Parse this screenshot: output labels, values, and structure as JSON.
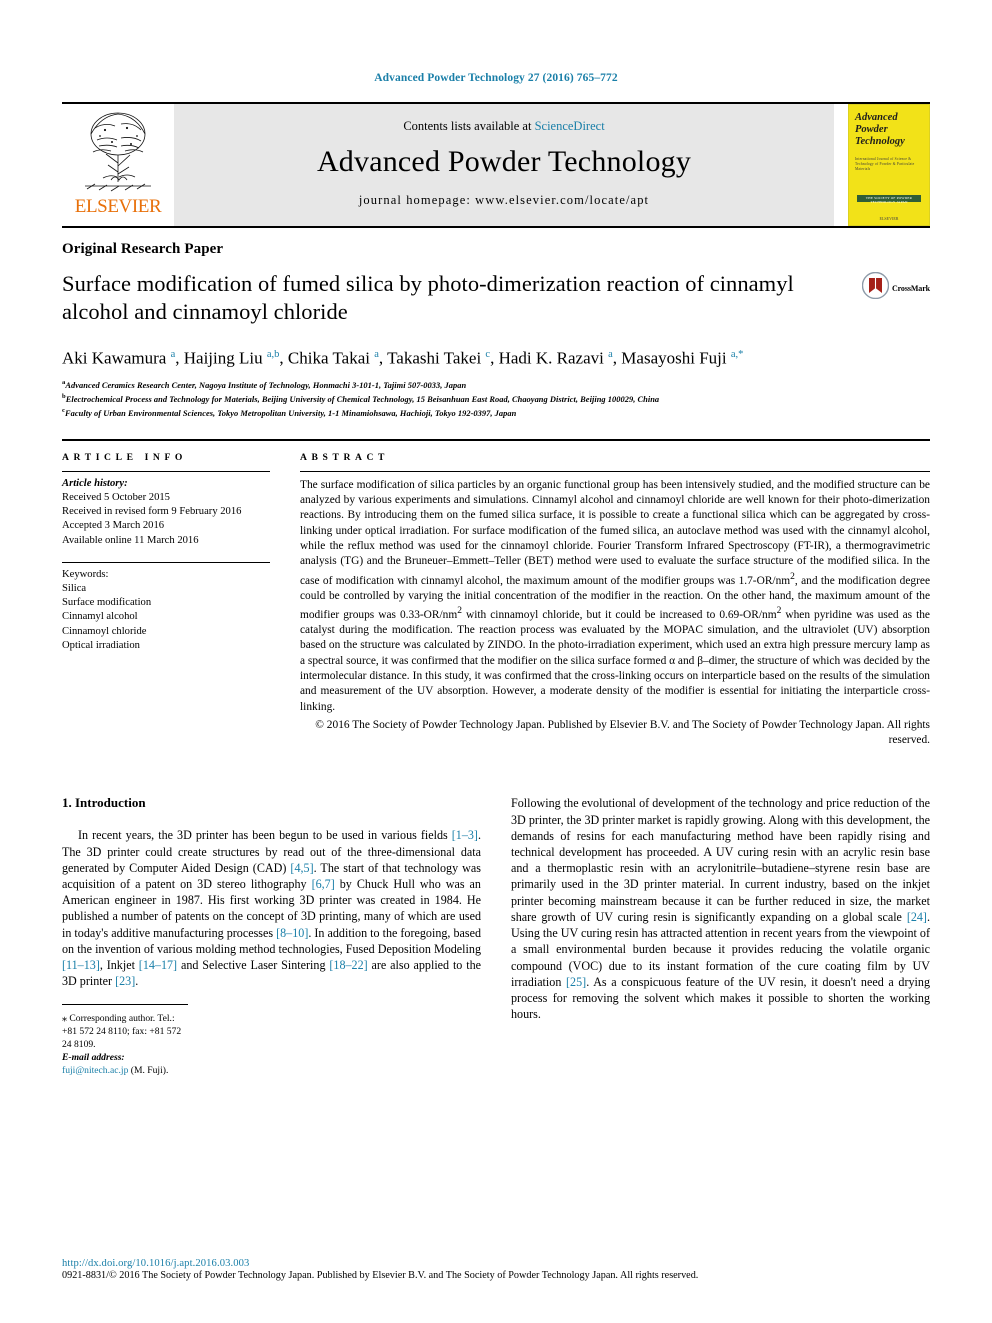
{
  "running_head": "Advanced Powder Technology 27 (2016) 765–772",
  "masthead": {
    "publisher_name": "ELSEVIER",
    "contents_prefix": "Contents lists available at ",
    "contents_link": "ScienceDirect",
    "journal_title": "Advanced Powder Technology",
    "homepage_line": "journal homepage: www.elsevier.com/locate/apt",
    "cover": {
      "line1": "Advanced",
      "line2": "Powder",
      "line3": "Technology",
      "subtitle": "International Journal of Science & Technology of Powder & Particulate Materials",
      "band_text": "THE SOCIETY OF POWDER TECHNOLOGY JAPAN",
      "foot_text": "ELSEVIER"
    }
  },
  "article": {
    "type": "Original Research Paper",
    "title": "Surface modification of fumed silica by photo-dimerization reaction of cinnamyl alcohol and cinnamoyl chloride",
    "crossmark_label": "CrossMark",
    "authors": "Aki Kawamura a , Haijing Liu a,b , Chika Takai a , Takashi Takei c , Hadi K. Razavi a , Masayoshi Fuji a,*",
    "affiliations": [
      {
        "marker": "a",
        "text": "Advanced Ceramics Research Center, Nagoya Institute of Technology, Honmachi 3-101-1, Tajimi 507-0033, Japan"
      },
      {
        "marker": "b",
        "text": "Electrochemical Process and Technology for Materials, Beijing University of Chemical Technology, 15 Beisanhuan East Road, Chaoyang District, Beijing 100029, China"
      },
      {
        "marker": "c",
        "text": "Faculty of Urban Environmental Sciences, Tokyo Metropolitan University, 1-1 Minamiohsawa, Hachioji, Tokyo 192-0397, Japan"
      }
    ]
  },
  "article_info": {
    "heading": "ARTICLE INFO",
    "history_label": "Article history:",
    "history": [
      "Received 5 October 2015",
      "Received in revised form 9 February 2016",
      "Accepted 3 March 2016",
      "Available online 11 March 2016"
    ],
    "keywords_label": "Keywords:",
    "keywords": [
      "Silica",
      "Surface modification",
      "Cinnamyl alcohol",
      "Cinnamoyl chloride",
      "Optical irradiation"
    ]
  },
  "abstract": {
    "heading": "ABSTRACT",
    "text": "The surface modification of silica particles by an organic functional group has been intensively studied, and the modified structure can be analyzed by various experiments and simulations. Cinnamyl alcohol and cinnamoyl chloride are well known for their photo-dimerization reactions. By introducing them on the fumed silica surface, it is possible to create a functional silica which can be aggregated by cross-linking under optical irradiation. For surface modification of the fumed silica, an autoclave method was used with the cinnamyl alcohol, while the reflux method was used for the cinnamoyl chloride. Fourier Transform Infrared Spectroscopy (FT-IR), a thermogravimetric analysis (TG) and the Bruneuer–Emmett–Teller (BET) method were used to evaluate the surface structure of the modified silica. In the case of modification with cinnamyl alcohol, the maximum amount of the modifier groups was 1.7-OR/nm2, and the modification degree could be controlled by varying the initial concentration of the modifier in the reaction. On the other hand, the maximum amount of the modifier groups was 0.33-OR/nm2 with cinnamoyl chloride, but it could be increased to 0.69-OR/nm2 when pyridine was used as the catalyst during the modification. The reaction process was evaluated by the MOPAC simulation, and the ultraviolet (UV) absorption based on the structure was calculated by ZINDO. In the photo-irradiation experiment, which used an extra high pressure mercury lamp as a spectral source, it was confirmed that the modifier on the silica surface formed α and β–dimer, the structure of which was decided by the intermolecular distance. In this study, it was confirmed that the cross-linking occurs on interparticle based on the results of the simulation and measurement of the UV absorption. However, a moderate density of the modifier is essential for initiating the interparticle cross-linking.",
    "copyright": "© 2016 The Society of Powder Technology Japan. Published by Elsevier B.V. and The Society of Powder Technology Japan. All rights reserved."
  },
  "introduction": {
    "heading": "1. Introduction",
    "left_paragraph": "In recent years, the 3D printer has been begun to be used in various fields [1–3]. The 3D printer could create structures by read out of the three-dimensional data generated by Computer Aided Design (CAD) [4,5]. The start of that technology was acquisition of a patent on 3D stereo lithography [6,7] by Chuck Hull who was an American engineer in 1987. His first working 3D printer was created in 1984. He published a number of patents on the concept of 3D printing, many of which are used in today's additive manufacturing processes [8–10]. In addition to the foregoing, based on the invention of various molding method technologies, Fused Deposition Modeling [11–13], Inkjet [14–17] and Selective Laser Sintering [18–22] are also applied to the 3D printer [23].",
    "right_paragraph": "Following the evolutional of development of the technology and price reduction of the 3D printer, the 3D printer market is rapidly growing. Along with this development, the demands of resins for each manufacturing method have been rapidly rising and technical development has proceeded. A UV curing resin with an acrylic resin base and a thermoplastic resin with an acrylonitrile–butadiene–styrene resin base are primarily used in the 3D printer material. In current industry, based on the inkjet printer becoming mainstream because it can be further reduced in size, the market share growth of UV curing resin is significantly expanding on a global scale [24]. Using the UV curing resin has attracted attention in recent years from the viewpoint of a small environmental burden because it provides reducing the volatile organic compound (VOC) due to its instant formation of the cure coating film by UV irradiation [25]. As a conspicuous feature of the UV resin, it doesn't need a drying process for removing the solvent which makes it possible to shorten the working hours."
  },
  "footnote": {
    "star": "⁎",
    "corresponding": "Corresponding author. Tel.: +81 572 24 8110; fax: +81 572 24 8109.",
    "email_label": "E-mail address:",
    "email": "fuji@nitech.ac.jp",
    "email_suffix": "(M. Fuji)."
  },
  "page_footer": {
    "doi": "http://dx.doi.org/10.1016/j.apt.2016.03.003",
    "issn_line": "0921-8831/© 2016 The Society of Powder Technology Japan. Published by Elsevier B.V. and The Society of Powder Technology Japan. All rights reserved."
  },
  "colors": {
    "link": "#1a7fa8",
    "elsevier_orange": "#e8700a",
    "cover_yellow": "#f2e218",
    "masthead_grey": "#e7e7e7",
    "crossmark_red": "#a52018"
  }
}
